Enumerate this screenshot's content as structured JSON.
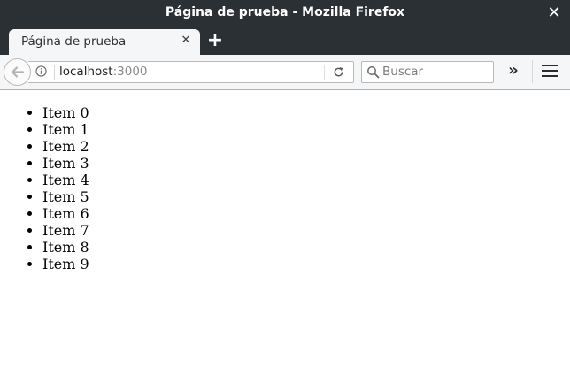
{
  "window": {
    "title": "Página de prueba - Mozilla Firefox"
  },
  "tabs": [
    {
      "label": "Página de prueba",
      "active": true
    }
  ],
  "navbar": {
    "url_host": "localhost",
    "url_port": ":3000",
    "search_placeholder": "Buscar"
  },
  "content": {
    "items": [
      "Item 0",
      "Item 1",
      "Item 2",
      "Item 3",
      "Item 4",
      "Item 5",
      "Item 6",
      "Item 7",
      "Item 8",
      "Item 9"
    ]
  },
  "icons": {
    "back": "back-arrow-icon",
    "info": "info-icon",
    "reload": "reload-icon",
    "search": "search-icon",
    "overflow": "chevron-double-right-icon",
    "menu": "hamburger-menu-icon",
    "tab_close": "close-icon",
    "new_tab": "plus-icon"
  },
  "colors": {
    "titlebar": "#2b3035",
    "toolbar": "#f5f6f7"
  }
}
